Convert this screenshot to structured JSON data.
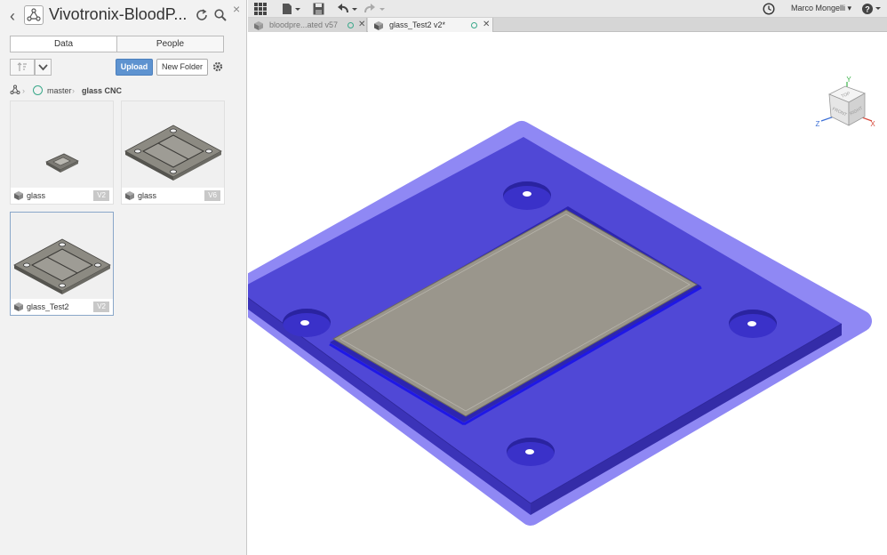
{
  "panel": {
    "title": "Vivotronix-BloodP...",
    "back_icon": "chevron-left-icon",
    "close_glyph": "×",
    "tabs": [
      {
        "label": "Data",
        "active": true
      },
      {
        "label": "People",
        "active": false
      }
    ],
    "upload_label": "Upload",
    "new_folder_label": "New Folder",
    "breadcrumb": {
      "branch": "master",
      "folder": "glass CNC"
    },
    "files": [
      {
        "name": "glass",
        "version": "V2"
      },
      {
        "name": "glass",
        "version": "V6"
      },
      {
        "name": "glass_Test2",
        "version": "V2",
        "selected": true
      }
    ]
  },
  "toolbar": {
    "user": "Marco Mongelli ▾"
  },
  "doc_tabs": [
    {
      "label": "bloodpre...ated v57",
      "active": false
    },
    {
      "label": "glass_Test2 v2*",
      "active": true
    }
  ],
  "viewcube": {
    "top": "TOP",
    "front": "FRONT",
    "right": "RIGHT",
    "axis_y": "Y",
    "axis_z": "Z",
    "axis_x": "X"
  },
  "colors": {
    "plate_top": "#5048d6",
    "plate_glow": "#8f88f4",
    "plate_side": "#3b33b8",
    "glass": "#9a968c",
    "accent": "#5e93d0"
  }
}
